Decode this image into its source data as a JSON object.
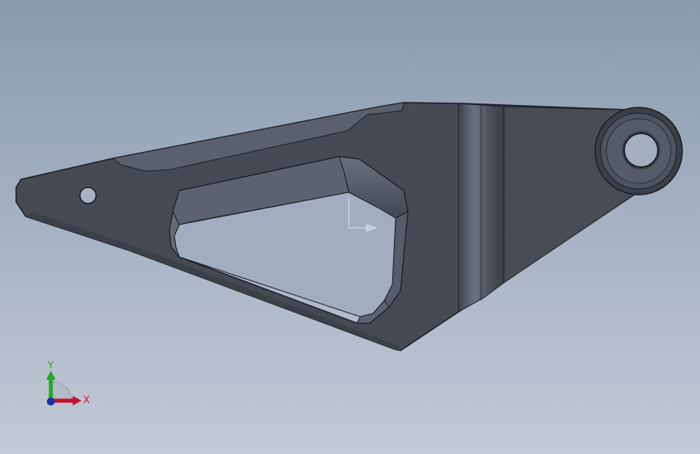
{
  "viewport": {
    "background_top": "#8a9aae",
    "background_bottom": "#c3cad6"
  },
  "part": {
    "body_color": "#454a54",
    "edge_color": "#1b1e24",
    "highlight_color": "#5e6471"
  },
  "triad": {
    "x_label": "X",
    "y_label": "Y",
    "x_color": "#c8102e",
    "y_color": "#22aa22",
    "z_color": "#1d2fb0"
  }
}
